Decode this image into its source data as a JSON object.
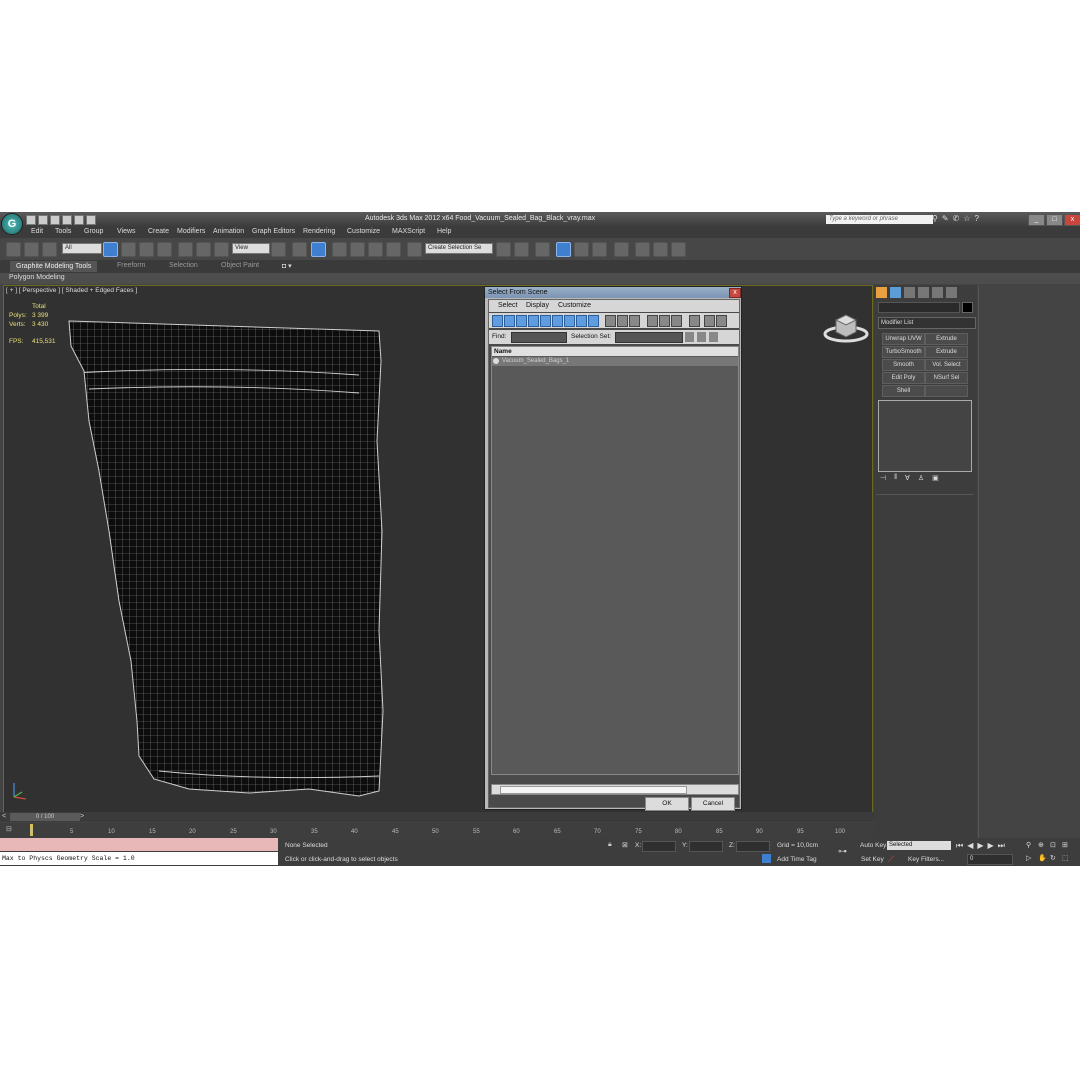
{
  "app": {
    "title": "Autodesk 3ds Max  2012 x64      Food_Vacuum_Sealed_Bag_Black_vray.max",
    "search_placeholder": "Type a keyword or phrase",
    "logo": "G"
  },
  "menu": [
    "Edit",
    "Tools",
    "Group",
    "Views",
    "Create",
    "Modifiers",
    "Animation",
    "Graph Editors",
    "Rendering",
    "Customize",
    "MAXScript",
    "Help"
  ],
  "toolbar": {
    "filter_value": "All",
    "view_value": "View",
    "named_selection": "Create Selection Se"
  },
  "ribbon": {
    "tabs": [
      "Graphite Modeling Tools",
      "Freeform",
      "Selection",
      "Object Paint"
    ],
    "sub_label": "Polygon Modeling"
  },
  "viewport": {
    "label": "[ + ] [ Perspective ] [ Shaded + Edged Faces ]",
    "total_label": "Total",
    "polys_label": "Polys:",
    "polys_value": "3 399",
    "verts_label": "Verts:",
    "verts_value": "3 430",
    "fps_label": "FPS:",
    "fps_value": "415,531",
    "viewcube_label": "FRONT"
  },
  "dialog": {
    "title": "Select From Scene",
    "close": "x",
    "menu": [
      "Select",
      "Display",
      "Customize"
    ],
    "find_label": "Find:",
    "selset_label": "Selection Set:",
    "column_name": "Name",
    "rows": [
      "Vacuum_Sealed_Bags_1"
    ],
    "ok": "OK",
    "cancel": "Cancel"
  },
  "command_panel": {
    "modifier_list": "Modifier List",
    "buttons": [
      "Unwrap UVW",
      "Extrude",
      "TurboSmooth",
      "Extrude",
      "Smooth",
      "Vol. Select",
      "Edit Poly",
      "NSurf Sel",
      "Shell",
      ""
    ]
  },
  "timeline": {
    "frame": "0 / 100",
    "ticks": [
      "0",
      "5",
      "10",
      "15",
      "20",
      "25",
      "30",
      "35",
      "40",
      "45",
      "50",
      "55",
      "60",
      "65",
      "70",
      "75",
      "80",
      "85",
      "90",
      "95",
      "100"
    ]
  },
  "status": {
    "script_line": "Max to Physcs Geometry Scale = 1.0",
    "selected": "None Selected",
    "prompt": "Click or click-and-drag to select objects",
    "x_label": "X:",
    "y_label": "Y:",
    "z_label": "Z:",
    "grid": "Grid = 10,0cm",
    "add_time_tag": "Add Time Tag",
    "auto_key": "Auto Key",
    "set_key": "Set Key",
    "selected_value": "Selected",
    "key_filters": "Key Filters...",
    "frame_value": "0"
  },
  "colors": {
    "viewport_bg": "#313131",
    "stats_text": "#e6e07a",
    "active_blue": "#3f7fd0"
  }
}
